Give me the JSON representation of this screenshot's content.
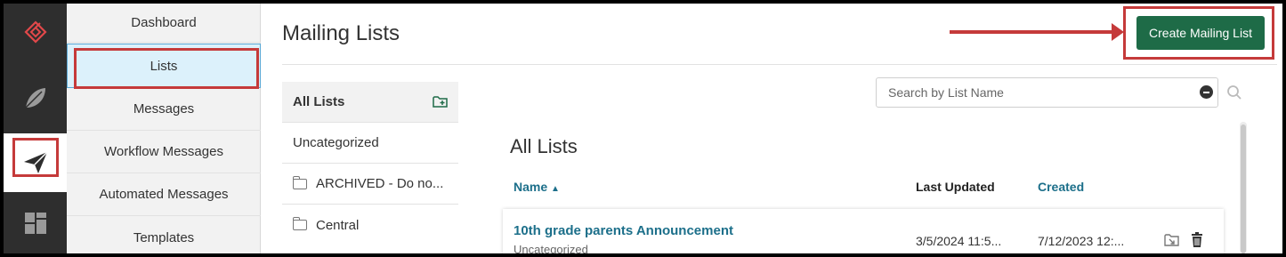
{
  "rail": {
    "icons": [
      "logo-icon",
      "leaf-icon",
      "paper-plane-icon",
      "dashboard-grid-icon"
    ],
    "colors": {
      "rail_bg": "#2e2e2e",
      "logo": "#e2484a",
      "icon": "#9a9a9a",
      "active_icon": "#2e2e2e"
    }
  },
  "nav": {
    "items": [
      {
        "label": "Dashboard"
      },
      {
        "label": "Lists"
      },
      {
        "label": "Messages"
      },
      {
        "label": "Workflow Messages"
      },
      {
        "label": "Automated Messages"
      },
      {
        "label": "Templates"
      }
    ],
    "active": "Lists"
  },
  "header": {
    "title": "Mailing Lists",
    "create_button": "Create Mailing List"
  },
  "folders": {
    "items": [
      {
        "label": "All Lists"
      },
      {
        "label": "Uncategorized"
      },
      {
        "label": "ARCHIVED - Do no..."
      },
      {
        "label": "Central"
      }
    ],
    "selected": "All Lists",
    "add_icon": "add-folder-icon"
  },
  "search": {
    "placeholder": "Search by List Name",
    "value": ""
  },
  "table": {
    "heading": "All Lists",
    "columns": {
      "name": "Name",
      "updated": "Last Updated",
      "created": "Created"
    },
    "sort_indicator": "▲",
    "rows": [
      {
        "name": "10th grade parents Announcement",
        "category": "Uncategorized",
        "updated": "3/5/2024 11:5...",
        "created": "7/12/2023 12:..."
      }
    ]
  },
  "colors": {
    "accent_green": "#1e6b47",
    "link_blue": "#1c6f8a",
    "annotation_red": "#c53a3a",
    "active_nav_bg": "#dcf1fb"
  }
}
